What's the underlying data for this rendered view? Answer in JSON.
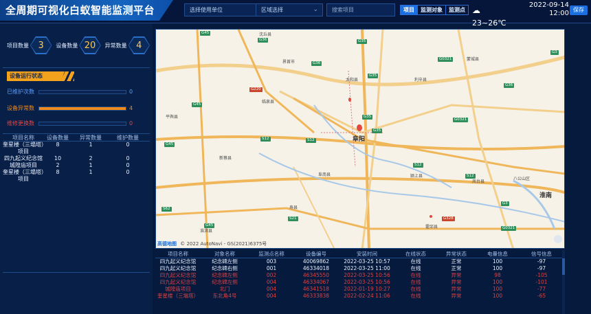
{
  "header": {
    "title": "全周期可视化白蚁智能监测平台",
    "unit_select_placeholder": "选择使用单位",
    "region_select_placeholder": "区域选择",
    "search_placeholder": "搜索项目",
    "tabs": [
      {
        "label": "项目",
        "active": true
      },
      {
        "label": "监测对象",
        "active": false
      },
      {
        "label": "监测点",
        "active": false
      }
    ],
    "weather_icon": "cloud-icon",
    "temperature": "23~26℃",
    "date": "2022-09-14",
    "time": "12:00",
    "save_label": "保存"
  },
  "counts": {
    "project_label": "项目数量",
    "project_value": "3",
    "device_label": "设备数量",
    "device_value": "20",
    "anomaly_label": "异常数量",
    "anomaly_value": "4"
  },
  "device_status": {
    "title": "设备运行状态",
    "rows": [
      {
        "label": "已维护次数",
        "value": 0,
        "max": 4,
        "label_color": "#5aa0ff",
        "value_color": "#5aa0ff"
      },
      {
        "label": "设备异常数",
        "value": 4,
        "max": 4,
        "label_color": "#f08a1a",
        "value_color": "#f08a1a"
      },
      {
        "label": "维修更换数",
        "value": 0,
        "max": 4,
        "label_color": "#e04646",
        "value_color": "#e04646"
      }
    ]
  },
  "project_table": {
    "headers": [
      "项目名称",
      "设备数量",
      "异常数量",
      "维护数量"
    ],
    "rows": [
      [
        "奎星楼（三塌塔）项目",
        "8",
        "1",
        "0"
      ],
      [
        "四九起义纪念馆",
        "10",
        "2",
        "0"
      ],
      [
        "城隍庙项目",
        "2",
        "1",
        "0"
      ],
      [
        "奎星楼（三塌塔）项目",
        "8",
        "1",
        "0"
      ]
    ]
  },
  "map": {
    "cities": [
      "阜阳",
      "淮南"
    ],
    "towns": [
      "沈丘县",
      "界首市",
      "太和县",
      "临泉县",
      "利辛县",
      "蒙城县",
      "平舆县",
      "新蔡县",
      "阜南县",
      "颍上县",
      "凤台县",
      "八公山区",
      "淮滨县",
      "霍邱县",
      "寿县"
    ],
    "roads": [
      "G45",
      "G36",
      "G36",
      "G35",
      "G0321",
      "G35",
      "G36",
      "G220",
      "G45",
      "G0321",
      "G35",
      "S12",
      "S12",
      "S12",
      "G45",
      "S12",
      "G3",
      "G35",
      "S62",
      "G45",
      "S21",
      "G328",
      "G0321",
      "G3"
    ],
    "attribution_logo": "高德地图",
    "attribution_text": "© 2022 AutoNavi - GS(2021)6375号"
  },
  "device_table": {
    "headers": [
      "项目名称",
      "对象名称",
      "监测点名称",
      "设备编号",
      "安装时间",
      "在线状态",
      "异常状态",
      "电量信息",
      "信号信息"
    ],
    "rows": [
      {
        "alarm": false,
        "cells": [
          "四九起义纪念馆",
          "纪念碑左侧",
          "003",
          "40069862",
          "2022-03-25 10:57",
          "在线",
          "正常",
          "100",
          "-97"
        ]
      },
      {
        "alarm": false,
        "cells": [
          "四九起义纪念馆",
          "纪念碑右侧",
          "001",
          "46334018",
          "2022-03-25 11:00",
          "在线",
          "正常",
          "100",
          "-97"
        ]
      },
      {
        "alarm": true,
        "cells": [
          "四九起义纪念馆",
          "纪念碑左侧",
          "002",
          "46345550",
          "2022-03-25 10:56",
          "在线",
          "异常",
          "98",
          "-105"
        ]
      },
      {
        "alarm": true,
        "cells": [
          "四九起义纪念馆",
          "纪念碑左侧",
          "004",
          "46334067",
          "2022-03-25 10:56",
          "在线",
          "异常",
          "100",
          "-101"
        ]
      },
      {
        "alarm": true,
        "cells": [
          "城隍庙项目",
          "北门",
          "004",
          "46341518",
          "2022-01-19 10:27",
          "在线",
          "异常",
          "100",
          "-77"
        ]
      },
      {
        "alarm": true,
        "cells": [
          "奎星楼（三塌塔）",
          "东北角4号",
          "004",
          "46333838",
          "2022-02-24 11:06",
          "在线",
          "异常",
          "100",
          "-65"
        ]
      }
    ]
  }
}
